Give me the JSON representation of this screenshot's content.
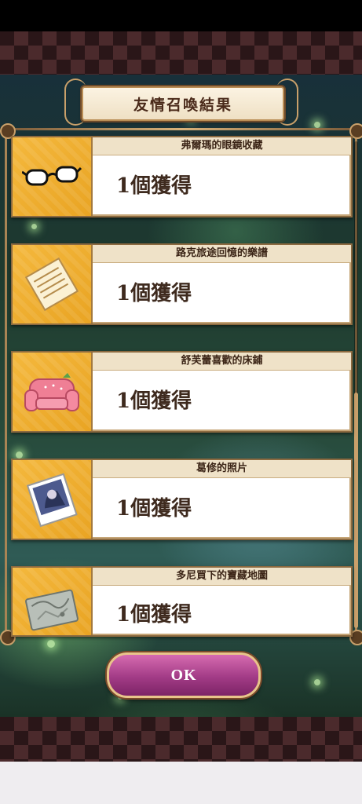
{
  "title": "友情召喚結果",
  "ok_label": "OK",
  "results": [
    {
      "name": "弗爾瑪的眼鏡收藏",
      "count": "1個獲得",
      "icon": "glasses-icon"
    },
    {
      "name": "路克旅途回憶的樂譜",
      "count": "1個獲得",
      "icon": "sheet-music-icon"
    },
    {
      "name": "舒芙蕾喜歡的床鋪",
      "count": "1個獲得",
      "icon": "sofa-bed-icon"
    },
    {
      "name": "葛修的照片",
      "count": "1個獲得",
      "icon": "photo-icon"
    },
    {
      "name": "多尼買下的寶藏地圖",
      "count": "1個獲得",
      "icon": "treasure-map-icon"
    }
  ],
  "colors": {
    "accent_gold": "#c9a06a",
    "ok_button": "#a23b86",
    "icon_bg": "#f0ae30"
  }
}
